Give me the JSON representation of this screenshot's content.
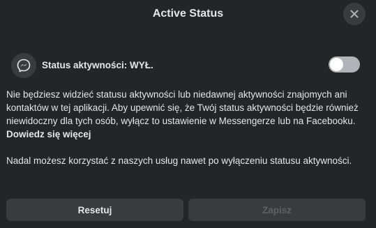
{
  "dialog": {
    "title": "Active Status",
    "close_icon": "close-icon"
  },
  "status": {
    "icon": "messenger-icon",
    "label": "Status aktywności: WYŁ.",
    "toggle_on": false
  },
  "description": {
    "text": "Nie będziesz widzieć statusu aktywności lub niedawnej aktywności znajomych ani kontaktów w tej aplikacji. Aby upewnić się, że Twój status aktywności będzie również niewidoczny dla tych osób, wyłącz to ustawienie w Messengerze lub na Facebooku. ",
    "link": "Dowiedz się więcej"
  },
  "note": {
    "text": "Nadal możesz korzystać z naszych usług nawet po wyłączeniu statusu aktywności."
  },
  "buttons": {
    "reset_label": "Resetuj",
    "save_label": "Zapisz"
  },
  "colors": {
    "background": "#242526",
    "text": "#e4e6eb",
    "button": "#3a3b3c",
    "toggle_off": "#b0b3b8",
    "disabled_text": "#5f6164"
  }
}
